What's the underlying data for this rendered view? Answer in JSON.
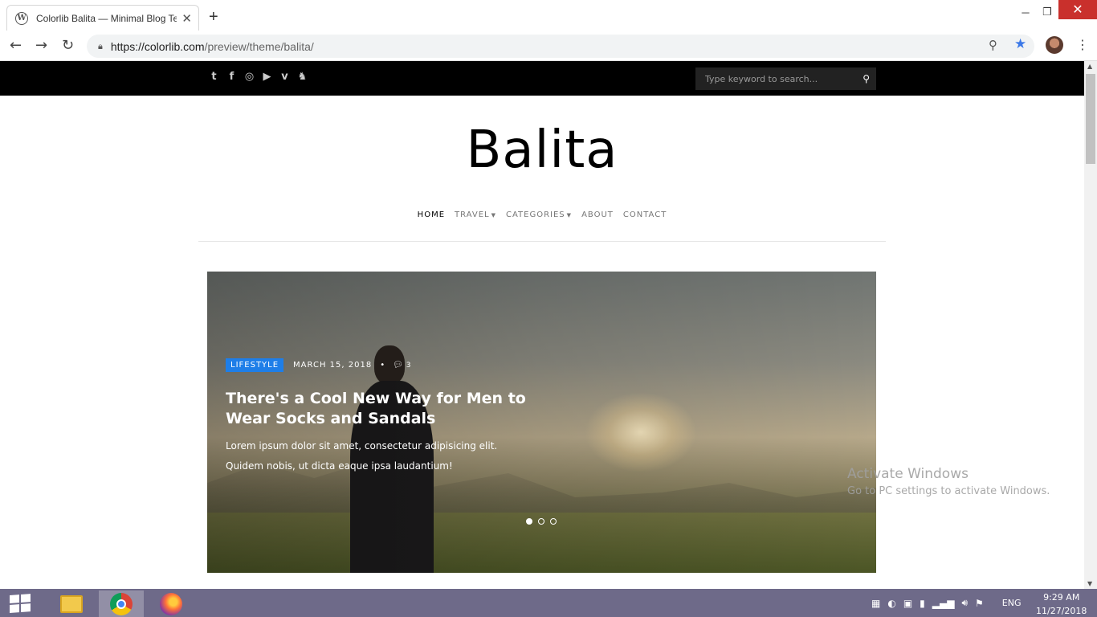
{
  "browser": {
    "tab_title": "Colorlib Balita — Minimal Blog Te",
    "tab_favicon": "W",
    "new_tab": "+",
    "url_host": "https://colorlib.com",
    "url_path": "/preview/theme/balita/",
    "icons": [
      "back-arrow-icon",
      "forward-arrow-icon",
      "reload-icon",
      "lock-icon",
      "zoom-icon",
      "star-icon",
      "profile-avatar",
      "menu-dots-icon"
    ]
  },
  "site": {
    "search_placeholder": "Type keyword to search...",
    "social_icons": [
      "twitter-icon",
      "facebook-icon",
      "instagram-icon",
      "youtube-icon",
      "vimeo-icon",
      "snapchat-icon"
    ],
    "logo": "Balita",
    "nav": {
      "home": "HOME",
      "travel": "TRAVEL",
      "categories": "CATEGORIES",
      "about": "ABOUT",
      "contact": "CONTACT"
    }
  },
  "hero": {
    "category": "LIFESTYLE",
    "date": "MARCH 15, 2018",
    "separator": "•",
    "comment_count": "3",
    "title": "There's a Cool New Way for Men to Wear Socks and Sandals",
    "excerpt": "Lorem ipsum dolor sit amet, consectetur adipisicing elit. Quidem nobis, ut dicta eaque ipsa laudantium!",
    "slide_count": 3,
    "active_slide": 1,
    "badge_color": "#1e7ee8"
  },
  "watermark": {
    "line1": "Activate Windows",
    "line2": "Go to PC settings to activate Windows."
  },
  "taskbar": {
    "language": "ENG",
    "time": "9:29 AM",
    "date": "11/27/2018",
    "color": "#6e6a89"
  }
}
